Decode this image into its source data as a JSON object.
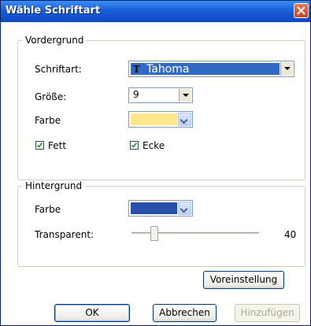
{
  "window": {
    "title": "Wähle Schriftart"
  },
  "foreground": {
    "group_label": "Vordergrund",
    "font_label": "Schriftart:",
    "font_value": "Tahoma",
    "size_label": "Größe:",
    "size_value": "9",
    "color_label": "Farbe",
    "color_value": "#ffe68a",
    "bold_label": "Fett",
    "bold_checked": true,
    "corner_label": "Ecke",
    "corner_checked": true
  },
  "background": {
    "group_label": "Hintergrund",
    "color_label": "Farbe",
    "color_value": "#2750a8",
    "transparent_label": "Transparent:",
    "transparent_value": "40"
  },
  "buttons": {
    "default_label": "Voreinstellung",
    "ok_label": "OK",
    "cancel_label": "Abbrechen",
    "add_label": "Hinzufügen"
  },
  "colors": {
    "titlebar": "#0d48c4",
    "selection": "#316ac5",
    "accent_border": "#7f9db9"
  }
}
